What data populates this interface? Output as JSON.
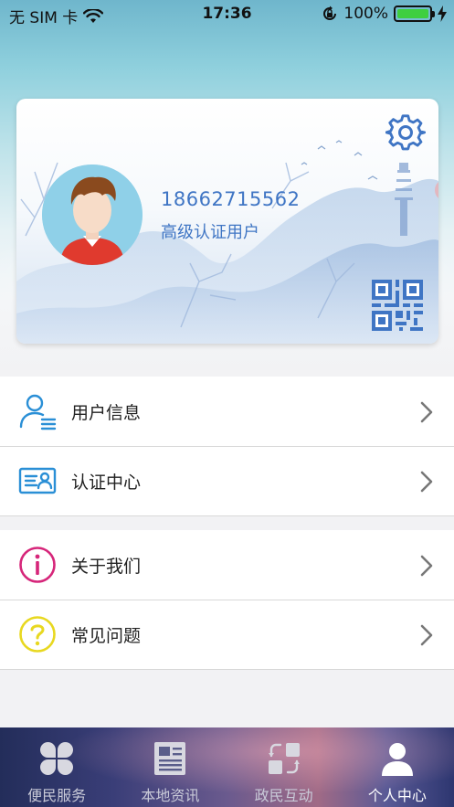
{
  "status_bar": {
    "carrier": "无 SIM 卡",
    "time": "17:36",
    "battery_percent": "100%",
    "battery_level": 1.0,
    "battery_color": "#3fcf3f"
  },
  "profile": {
    "phone": "18662715562",
    "level": "高级认证用户",
    "accent_color": "#3f75c4",
    "settings_icon": "gear-icon",
    "qr_icon": "qr-code-icon"
  },
  "menu": {
    "group1": [
      {
        "label": "用户信息",
        "icon": "user-info-icon",
        "color": "#2a8fd6"
      },
      {
        "label": "认证中心",
        "icon": "id-card-icon",
        "color": "#2a8fd6"
      }
    ],
    "group2": [
      {
        "label": "关于我们",
        "icon": "info-circle-icon",
        "color": "#d6267a"
      },
      {
        "label": "常见问题",
        "icon": "question-circle-icon",
        "color": "#e8d820"
      }
    ]
  },
  "tabbar": {
    "tabs": [
      {
        "label": "便民服务",
        "icon": "clover-icon",
        "active": false
      },
      {
        "label": "本地资讯",
        "icon": "newspaper-icon",
        "active": false
      },
      {
        "label": "政民互动",
        "icon": "exchange-icon",
        "active": false
      },
      {
        "label": "个人中心",
        "icon": "person-icon",
        "active": true
      }
    ]
  }
}
